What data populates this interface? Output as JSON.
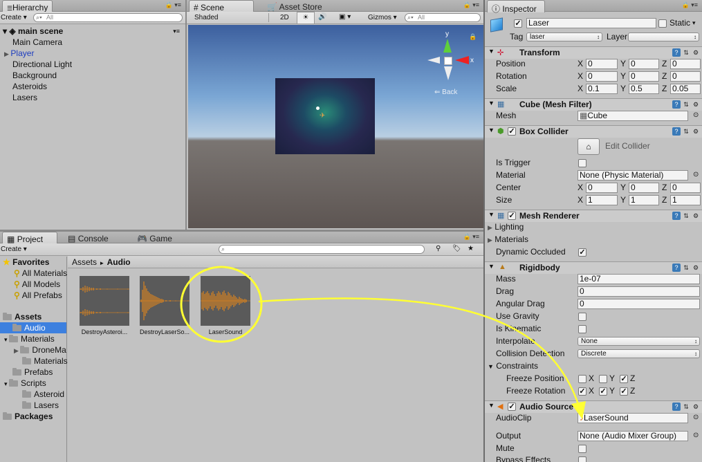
{
  "hierarchy": {
    "tab": "Hierarchy",
    "create": "Create",
    "search_placeholder": "All",
    "scene": "main scene",
    "items": [
      "Main Camera",
      "Player",
      "Directional Light",
      "Background",
      "Asteroids",
      "Lasers"
    ]
  },
  "scene_view": {
    "tabs": [
      "Scene",
      "Asset Store"
    ],
    "shading": "Shaded",
    "mode_2d": "2D",
    "gizmos": "Gizmos",
    "search_placeholder": "All",
    "axis_y": "y",
    "axis_x": "x",
    "back_label": "Back"
  },
  "project": {
    "tabs": [
      "Project",
      "Console",
      "Game"
    ],
    "create": "Create",
    "favorites_label": "Favorites",
    "favorites": [
      "All Materials",
      "All Models",
      "All Prefabs"
    ],
    "assets_label": "Assets",
    "tree": [
      {
        "label": "Audio",
        "depth": 1,
        "selected": true
      },
      {
        "label": "Materials",
        "depth": 1,
        "expanded": true
      },
      {
        "label": "DroneMa",
        "depth": 2,
        "collapsed": true
      },
      {
        "label": "Materials",
        "depth": 2
      },
      {
        "label": "Prefabs",
        "depth": 1
      },
      {
        "label": "Scripts",
        "depth": 1,
        "expanded": true
      },
      {
        "label": "Asteroid",
        "depth": 2
      },
      {
        "label": "Lasers",
        "depth": 2
      }
    ],
    "packages_label": "Packages",
    "breadcrumb_root": "Assets",
    "breadcrumb_sep": "►",
    "breadcrumb_current": "Audio",
    "assets": [
      "DestroyAsteroi...",
      "DestroyLaserSo...",
      "LaserSound"
    ]
  },
  "inspector": {
    "tab": "Inspector",
    "object_name": "Laser",
    "static_label": "Static",
    "tag_label": "Tag",
    "tag_value": "laser",
    "layer_label": "Layer",
    "layer_value": "",
    "transform": {
      "title": "Transform",
      "rows": [
        {
          "label": "Position",
          "x": "0",
          "y": "0",
          "z": "0"
        },
        {
          "label": "Rotation",
          "x": "0",
          "y": "0",
          "z": "0"
        },
        {
          "label": "Scale",
          "x": "0.1",
          "y": "0.5",
          "z": "0.05"
        }
      ]
    },
    "mesh_filter": {
      "title": "Cube (Mesh Filter)",
      "mesh_label": "Mesh",
      "mesh_value": "Cube"
    },
    "box_collider": {
      "title": "Box Collider",
      "edit_button": "Edit Collider",
      "is_trigger_label": "Is Trigger",
      "material_label": "Material",
      "material_value": "None (Physic Material)",
      "center_label": "Center",
      "center": {
        "x": "0",
        "y": "0",
        "z": "0"
      },
      "size_label": "Size",
      "size": {
        "x": "1",
        "y": "1",
        "z": "1"
      }
    },
    "mesh_renderer": {
      "title": "Mesh Renderer",
      "lighting": "Lighting",
      "materials": "Materials",
      "dynamic_occluded": "Dynamic Occluded"
    },
    "rigidbody": {
      "title": "Rigidbody",
      "mass_label": "Mass",
      "mass": "1e-07",
      "drag_label": "Drag",
      "drag": "0",
      "angular_drag_label": "Angular Drag",
      "angular_drag": "0",
      "use_gravity_label": "Use Gravity",
      "is_kinematic_label": "Is Kinematic",
      "interpolate_label": "Interpolate",
      "interpolate": "None",
      "collision_label": "Collision Detection",
      "collision": "Discrete",
      "constraints_label": "Constraints",
      "freeze_pos_label": "Freeze Position",
      "freeze_rot_label": "Freeze Rotation",
      "axes": [
        "X",
        "Y",
        "Z"
      ]
    },
    "audio_source": {
      "title": "Audio Source",
      "clip_label": "AudioClip",
      "clip_value": "LaserSound",
      "output_label": "Output",
      "output_value": "None (Audio Mixer Group)",
      "mute_label": "Mute",
      "bypass_label": "Bypass Effects"
    }
  },
  "colors": {
    "selection": "#3d80df",
    "highlight": "#ffff33",
    "waveform": "#f08a14"
  }
}
